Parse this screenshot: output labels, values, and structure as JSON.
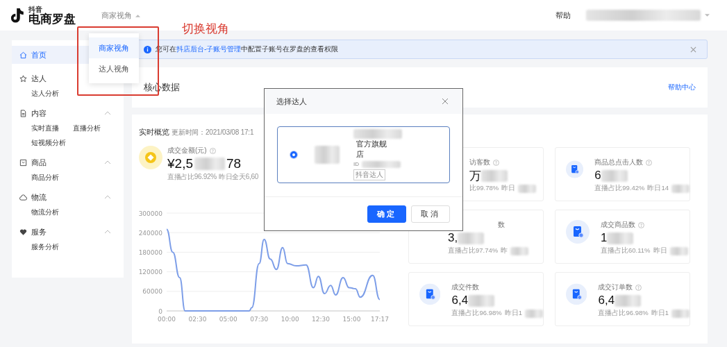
{
  "header": {
    "logo_small": "抖音",
    "logo": "电商罗盘",
    "view_switcher": "商家视角",
    "help": "帮助"
  },
  "view_menu": [
    {
      "label": "商家视角",
      "selected": true
    },
    {
      "label": "达人视角",
      "selected": false
    }
  ],
  "annotation": "切换视角",
  "sidebar": [
    {
      "label": "首页",
      "selected": true
    },
    {
      "label": "达人",
      "selected": false,
      "children": [
        {
          "label": "达人分析",
          "selected": false
        }
      ]
    },
    {
      "label": "内容",
      "selected": false,
      "expanded": true,
      "children": [
        {
          "label": "实时直播",
          "selected": false
        },
        {
          "label": "直播分析",
          "selected": false
        },
        {
          "label": "短视频分析",
          "selected": false
        }
      ]
    },
    {
      "label": "商品",
      "selected": false,
      "expanded": true,
      "children": [
        {
          "label": "商品分析",
          "selected": false
        }
      ]
    },
    {
      "label": "物流",
      "selected": false,
      "expanded": true,
      "children": [
        {
          "label": "物流分析",
          "selected": false
        }
      ]
    },
    {
      "label": "服务",
      "selected": false,
      "expanded": true,
      "children": [
        {
          "label": "服务分析",
          "selected": false
        }
      ]
    }
  ],
  "banner": {
    "before": "您可在",
    "link": "抖店后台-子账号管理",
    "after": "中配置子账号在罗盘的查看权限"
  },
  "core": {
    "title": "核心数据",
    "help_link": "帮助中心"
  },
  "overview": {
    "title": "实时概览",
    "updated": "更新时间：2021/03/08 17:1",
    "main_metric": {
      "label": "成交金额(元)",
      "hint": true,
      "value_start": "¥2,5",
      "value_end": "78",
      "share": "直播占比96.92%",
      "yesterday": "昨日全天6,60"
    },
    "chart_data": {
      "type": "line",
      "x": [
        0,
        0.5,
        1.05,
        1.5,
        3,
        5,
        6.7,
        6.9,
        7.5,
        7.9,
        8.4,
        8.9,
        9.4,
        9.8,
        10.5,
        11.3,
        11.9,
        12.3,
        12.8,
        13.3,
        13.7,
        14.3,
        14.8,
        15.3,
        15.7,
        16.7,
        17.28
      ],
      "grid": true,
      "series": [
        {
          "color": "#7d9ee8",
          "values": [
            250000,
            180000,
            102000,
            0,
            0,
            0,
            0,
            10000,
            145000,
            219000,
            159000,
            127000,
            194000,
            145000,
            138000,
            141000,
            71000,
            106000,
            53000,
            78000,
            49000,
            102000,
            71000,
            68000,
            42000,
            109000,
            35000
          ]
        }
      ],
      "ylim": [
        0,
        300000
      ],
      "yticks": [
        0,
        60000,
        120000,
        180000,
        240000,
        300000
      ],
      "xlim": [
        0,
        17.28
      ],
      "xticks": [
        {
          "value": 0,
          "label": "00:00"
        },
        {
          "value": 2.5,
          "label": "02:30"
        },
        {
          "value": 5,
          "label": "05:00"
        },
        {
          "value": 7.5,
          "label": "07:30"
        },
        {
          "value": 10,
          "label": "10:00"
        },
        {
          "value": 12.5,
          "label": "12:30"
        },
        {
          "value": 15,
          "label": "15:00"
        },
        {
          "value": 17.28,
          "label": "17:17"
        }
      ]
    },
    "metrics": [
      {
        "label": "访客数",
        "hint": true,
        "value": "万",
        "share": "比99.78%",
        "yesterday": "昨日"
      },
      {
        "label": "商品总点击人数",
        "hint": true,
        "value": "6",
        "share": "直播占比99.42%",
        "yesterday": "昨日14"
      },
      {
        "label": "数",
        "hint": false,
        "value": "3,",
        "share": "直播占比97.74%",
        "yesterday": "昨"
      },
      {
        "label": "成交商品数",
        "hint": true,
        "value": "1",
        "share": "直播占比60.11%",
        "yesterday": "昨日"
      },
      {
        "label": "成交件数",
        "hint": false,
        "value": "6,4",
        "share": "直播占比96.98%",
        "yesterday": "昨日1"
      },
      {
        "label": "成交订单数",
        "hint": true,
        "value": "6,4",
        "share": "直播占比96.98%",
        "yesterday": "昨日1"
      }
    ]
  },
  "modal": {
    "title": "选择达人",
    "option": {
      "selected": true,
      "name": "官方旗舰店",
      "id_label": "ID",
      "tag": "抖音达人"
    },
    "ok": "确定",
    "cancel": "取消"
  }
}
